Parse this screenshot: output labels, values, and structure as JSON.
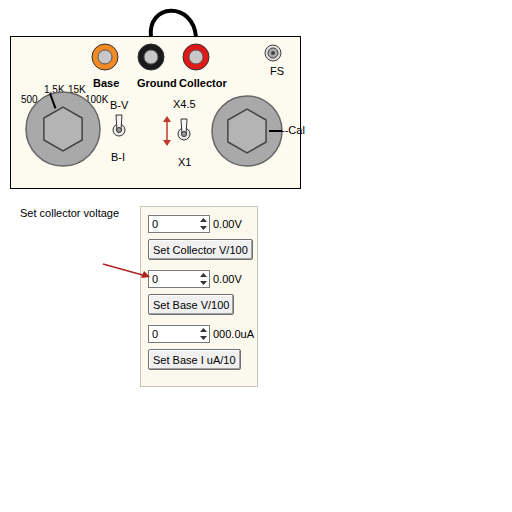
{
  "panel": {
    "jacks": [
      {
        "label": "Base",
        "color": "#f08a24"
      },
      {
        "label": "Ground",
        "color": "#1a1a1a"
      },
      {
        "label": "Collector",
        "color": "#e01818"
      }
    ],
    "fs": {
      "label": "FS"
    },
    "range_knob": {
      "labels": [
        {
          "text": "500",
          "selected": false
        },
        {
          "text": "1.5K",
          "selected": true
        },
        {
          "text": "15K",
          "selected": false
        },
        {
          "text": "100K",
          "selected": false
        }
      ]
    },
    "mode_switch": {
      "top": "B-V",
      "bottom": "B-I",
      "up": true
    },
    "gain_switch": {
      "top": "X4.5",
      "bottom": "X1",
      "up": true
    },
    "cal_knob": {
      "label": "--Cal"
    }
  },
  "annotation": {
    "text": "Set collector voltage"
  },
  "controls": [
    {
      "value": "0",
      "reading": "0.00V",
      "button": "Set Collector V/100"
    },
    {
      "value": "0",
      "reading": "0.00V",
      "button": "Set Base V/100"
    },
    {
      "value": "0",
      "reading": "000.0uA",
      "button": "Set Base I uA/10"
    }
  ]
}
